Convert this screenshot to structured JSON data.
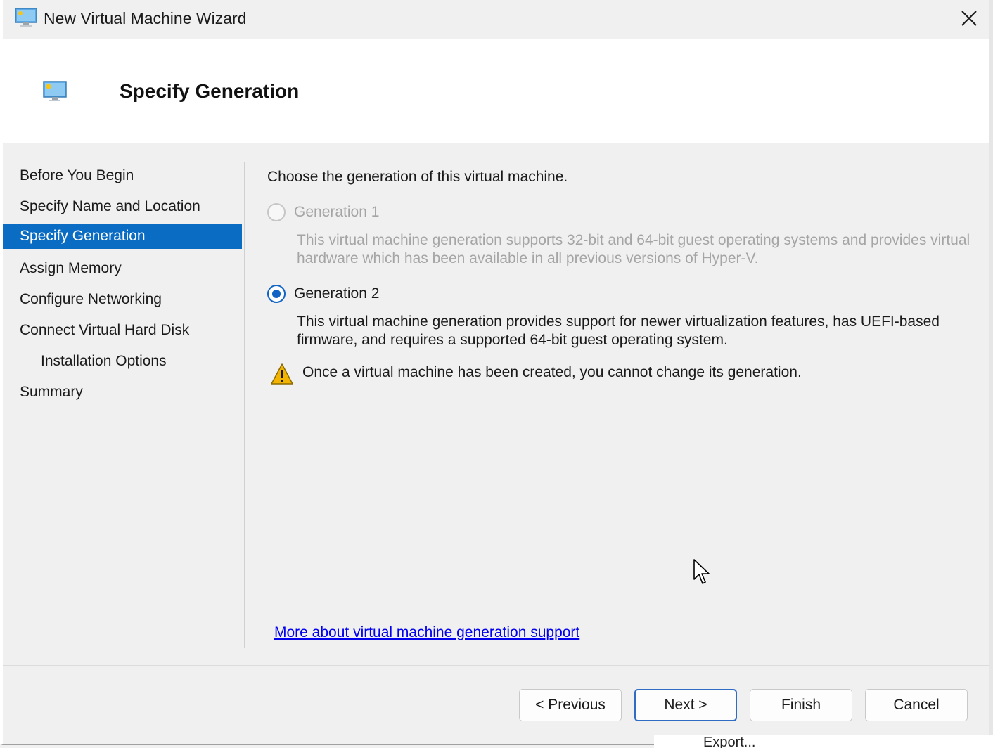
{
  "window": {
    "title": "New Virtual Machine Wizard"
  },
  "header": {
    "title": "Specify Generation"
  },
  "steps": [
    {
      "label": "Before You Begin",
      "active": false,
      "sub": false
    },
    {
      "label": "Specify Name and Location",
      "active": false,
      "sub": false
    },
    {
      "label": "Specify Generation",
      "active": true,
      "sub": false
    },
    {
      "label": "Assign Memory",
      "active": false,
      "sub": false
    },
    {
      "label": "Configure Networking",
      "active": false,
      "sub": false
    },
    {
      "label": "Connect Virtual Hard Disk",
      "active": false,
      "sub": false
    },
    {
      "label": "Installation Options",
      "active": false,
      "sub": true
    },
    {
      "label": "Summary",
      "active": false,
      "sub": false
    }
  ],
  "content": {
    "prompt": "Choose the generation of this virtual machine.",
    "generation1": {
      "label": "Generation 1",
      "enabled": false,
      "selected": false,
      "description": "This virtual machine generation supports 32-bit and 64-bit guest operating systems and provides virtual hardware which has been available in all previous versions of Hyper-V."
    },
    "generation2": {
      "label": "Generation 2",
      "enabled": true,
      "selected": true,
      "description": "This virtual machine generation provides support for newer virtualization features, has UEFI-based firmware, and requires a supported 64-bit guest operating system."
    },
    "warning": "Once a virtual machine has been created, you cannot change its generation.",
    "more_link": "More about virtual machine generation support"
  },
  "buttons": {
    "previous": "< Previous",
    "next": "Next >",
    "finish": "Finish",
    "cancel": "Cancel"
  },
  "background_window": {
    "partial_text": "Export..."
  },
  "colors": {
    "selection": "#0a6cc2",
    "link": "#0000ee",
    "radio_selected": "#1264c4",
    "warning": "#f2b400"
  },
  "icons": {
    "title": "virtual-machine-icon",
    "header": "virtual-machine-icon",
    "close": "close-icon",
    "warning": "warning-icon",
    "cursor": "mouse-pointer-icon"
  }
}
